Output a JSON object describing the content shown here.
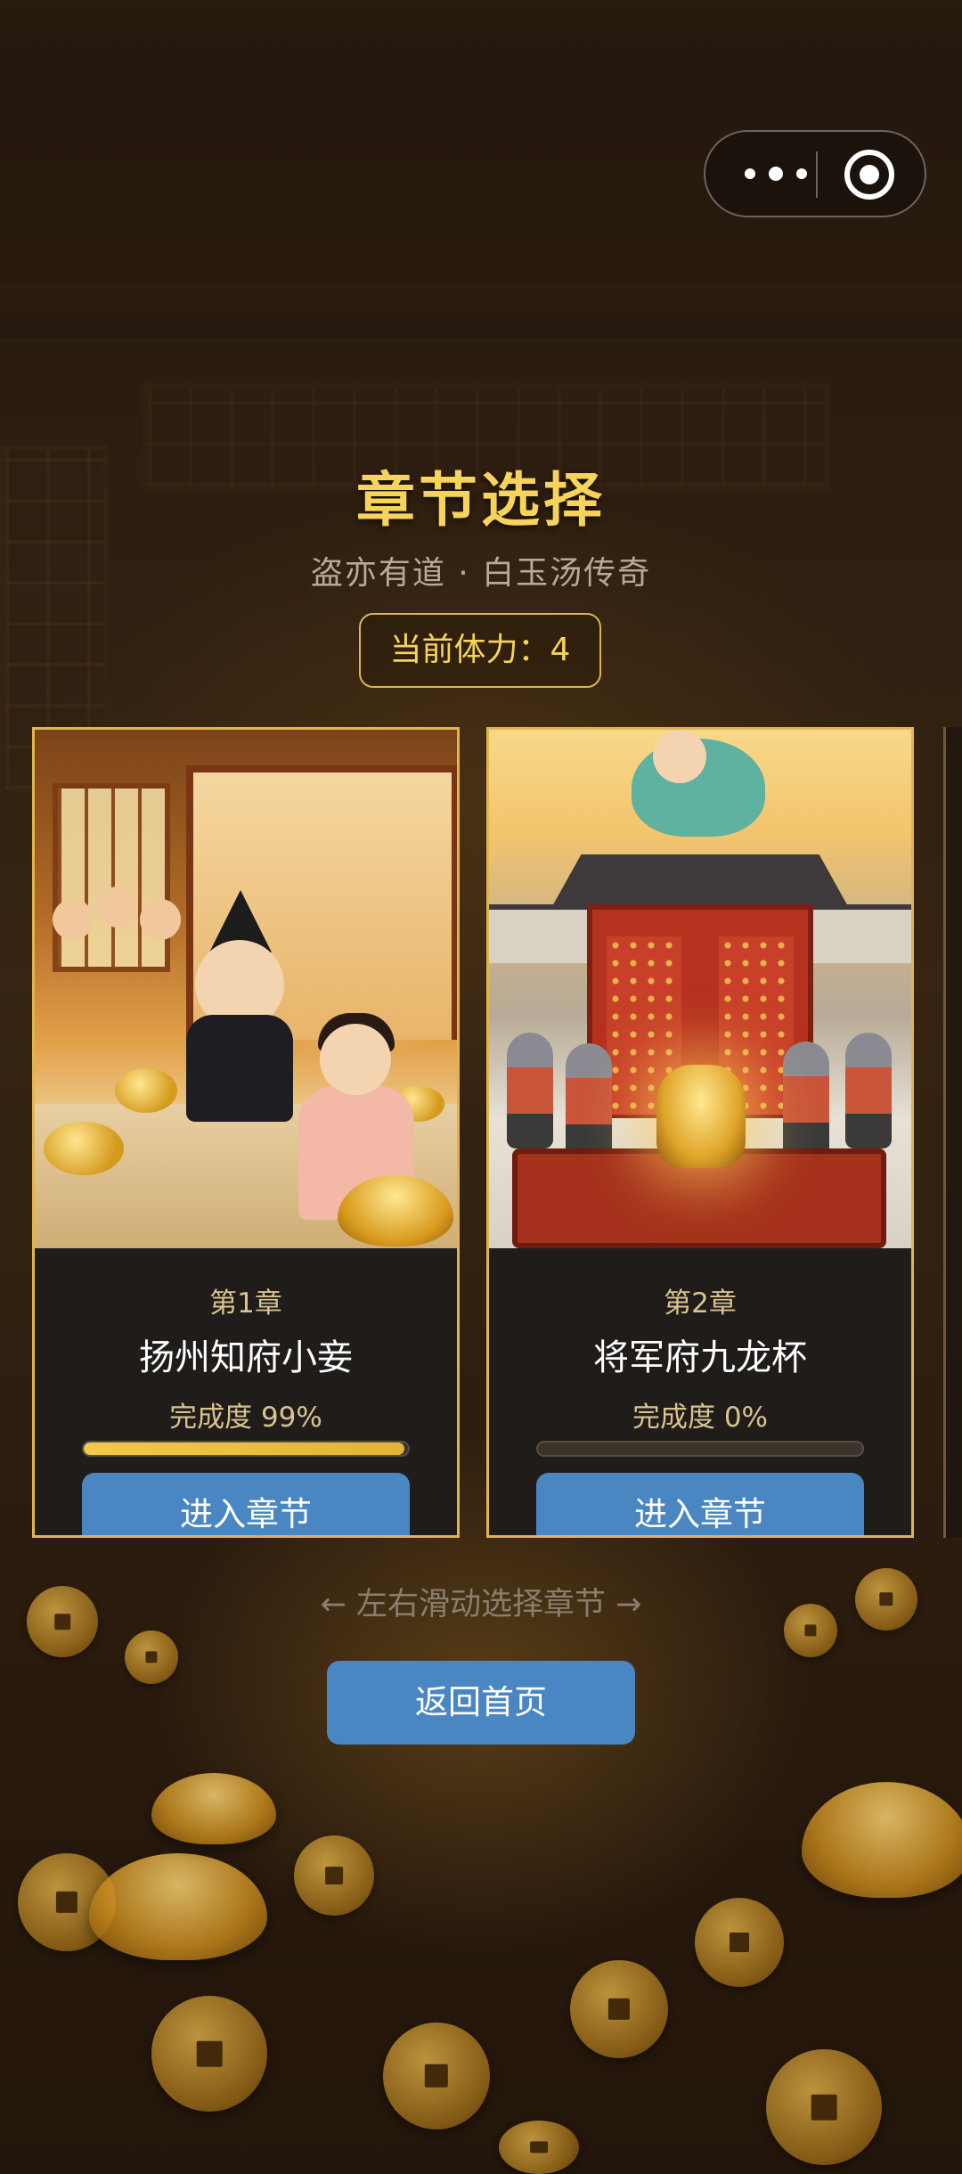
{
  "header": {
    "title": "章节选择",
    "subtitle": "盗亦有道 · 白玉汤传奇",
    "stamina": "当前体力：4"
  },
  "capsule": {
    "menu_icon": "more-dots-icon",
    "close_icon": "target-icon"
  },
  "chapters": [
    {
      "number": "第1章",
      "name": "扬州知府小妾",
      "progress_label": "完成度 99%",
      "progress": 0.99,
      "button": "进入章节"
    },
    {
      "number": "第2章",
      "name": "将军府九龙杯",
      "progress_label": "完成度 0%",
      "progress": 0.0,
      "button": "进入章节"
    }
  ],
  "swipe_hint": "← 左右滑动选择章节 →",
  "home_button": "返回首页",
  "colors": {
    "accent_gold": "#f6d35b",
    "button_blue": "#4a87c2",
    "card_border": "#e0b54c"
  }
}
